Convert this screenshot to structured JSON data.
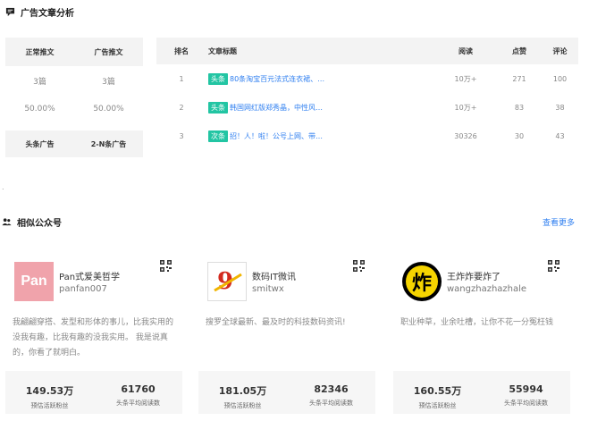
{
  "ad_section": {
    "title": "广告文章分析",
    "stats": {
      "headers": [
        "正常推文",
        "广告推文"
      ],
      "counts": [
        "3篇",
        "3篇"
      ],
      "percents": [
        "50.00%",
        "50.00%"
      ],
      "footer": [
        "头条广告",
        "2-N条广告"
      ]
    },
    "table": {
      "headers": {
        "rank": "排名",
        "title": "文章标题",
        "reads": "阅读",
        "likes": "点赞",
        "comments": "评论"
      },
      "rows": [
        {
          "rank": "1",
          "tag": "头条",
          "title": "80条淘宝百元法式连衣裙、…",
          "reads": "10万+",
          "likes": "271",
          "comments": "100"
        },
        {
          "rank": "2",
          "tag": "头条",
          "title": "韩国网红版郑秀晶，中性风…",
          "reads": "10万+",
          "likes": "83",
          "comments": "38"
        },
        {
          "rank": "3",
          "tag": "次条",
          "title": "招！人！啦！公号上网、带…",
          "reads": "30326",
          "likes": "30",
          "comments": "43"
        }
      ]
    }
  },
  "similar_section": {
    "title": "相似公众号",
    "more_label": "查看更多",
    "cards": [
      {
        "avatar_text": "Pan",
        "name": "Pan式爱美哲学",
        "id": "panfan007",
        "desc": "我翩翩穿搭、发型和形体的事儿，比我实用的没我有趣，比我有趣的没我实用。 我是说真的，你看了就明白。",
        "fans": "149.53万",
        "fans_label": "预估活跃粉丝",
        "avg_reads": "61760",
        "avg_reads_label": "头条平均阅读数"
      },
      {
        "avatar_text": "9",
        "name": "数码IT微讯",
        "id": "smitwx",
        "desc": "搜罗全球最新、最及时的科技数码资讯!",
        "fans": "181.05万",
        "fans_label": "预估活跃粉丝",
        "avg_reads": "82346",
        "avg_reads_label": "头条平均阅读数"
      },
      {
        "avatar_text": "炸",
        "name": "王炸炸要炸了",
        "id": "wangzhazhazhale",
        "desc": "职业种草，业余吐槽，让你不花一分冤枉钱",
        "fans": "160.55万",
        "fans_label": "预估活跃粉丝",
        "avg_reads": "55994",
        "avg_reads_label": "头条平均阅读数"
      }
    ]
  }
}
